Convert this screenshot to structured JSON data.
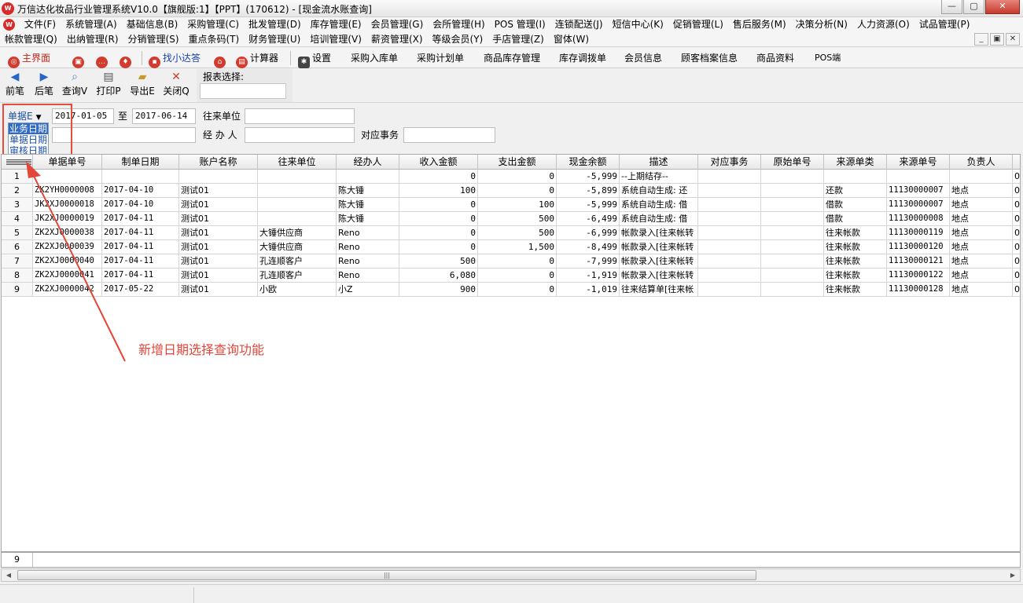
{
  "window": {
    "title": "万信达化妆品行业管理系统V10.0【旗舰版:1】【PPT】(170612) - [现金流水账查询]",
    "buttons": [
      "—",
      "▢",
      "✕"
    ]
  },
  "menubar_row1": [
    "文件(F)",
    "系统管理(A)",
    "基础信息(B)",
    "采购管理(C)",
    "批发管理(D)",
    "库存管理(E)",
    "会员管理(G)",
    "会所管理(H)",
    "POS 管理(I)",
    "连锁配送(J)",
    "短信中心(K)",
    "促销管理(L)",
    "售后服务(M)",
    "决策分析(N)",
    "人力资源(O)",
    "试品管理(P)"
  ],
  "menubar_row2": [
    "帐款管理(Q)",
    "出纳管理(R)",
    "分销管理(S)",
    "重点条码(T)",
    "财务管理(U)",
    "培训管理(V)",
    "薪资管理(X)",
    "等级会员(Y)",
    "手店管理(Z)",
    "窗体(W)"
  ],
  "mdi_buttons": [
    "_",
    "▣",
    "✕"
  ],
  "quickbar": {
    "home": "主界面",
    "find": "找小达答",
    "calc": "计算器",
    "settings": "设置",
    "links": [
      "采购入库单",
      "采购计划单",
      "商品库存管理",
      "库存调拨单",
      "会员信息",
      "顾客档案信息",
      "商品资料",
      "POS端"
    ]
  },
  "toolbar": {
    "prev": "前笔",
    "next": "后笔",
    "query": "查询V",
    "print": "打印P",
    "export": "导出E",
    "close": "关闭Q",
    "report_label": "报表选择:",
    "report_value": ""
  },
  "filter": {
    "date_type_label": "单据E",
    "date_type_options": [
      "业务日期",
      "单据日期",
      "审核日期"
    ],
    "date_from": "2017-01-05",
    "to_label": "至",
    "date_to": "2017-06-14",
    "partner_label": "往来单位",
    "partner_value": "",
    "handler_label": "经 办 人",
    "handler_value": "",
    "affair_label": "对应事务",
    "affair_value": ""
  },
  "table": {
    "columns": [
      "单据单号",
      "制单日期",
      "账户名称",
      "往来单位",
      "经办人",
      "收入金额",
      "支出金额",
      "现金余额",
      "描述",
      "对应事务",
      "原始单号",
      "来源单类",
      "来源单号",
      "负责人"
    ],
    "rows": [
      [
        "1",
        "",
        "",
        "",
        "",
        "",
        "0",
        "0",
        "-5,999",
        "--上期结存--",
        "",
        "",
        "",
        "",
        ""
      ],
      [
        "2",
        "ZK2YH0000008",
        "2017-04-10",
        "测试01",
        "",
        "陈大锤",
        "100",
        "0",
        "-5,899",
        "系统自动生成: 还",
        "",
        "",
        "还款",
        "11130000007",
        "地点"
      ],
      [
        "3",
        "JK2XJ0000018",
        "2017-04-10",
        "测试01",
        "",
        "陈大锤",
        "0",
        "100",
        "-5,999",
        "系统自动生成: 借",
        "",
        "",
        "借款",
        "11130000007",
        "地点"
      ],
      [
        "4",
        "JK2XJ0000019",
        "2017-04-11",
        "测试01",
        "",
        "陈大锤",
        "0",
        "500",
        "-6,499",
        "系统自动生成: 借",
        "",
        "",
        "借款",
        "11130000008",
        "地点"
      ],
      [
        "5",
        "ZK2XJ0000038",
        "2017-04-11",
        "测试01",
        "大锤供应商",
        "Reno",
        "0",
        "500",
        "-6,999",
        "帐款录入[往来帐转",
        "",
        "",
        "往来帐款",
        "11130000119",
        "地点"
      ],
      [
        "6",
        "ZK2XJ0000039",
        "2017-04-11",
        "测试01",
        "大锤供应商",
        "Reno",
        "0",
        "1,500",
        "-8,499",
        "帐款录入[往来帐转",
        "",
        "",
        "往来帐款",
        "11130000120",
        "地点"
      ],
      [
        "7",
        "ZK2XJ0000040",
        "2017-04-11",
        "测试01",
        "孔连顺客户",
        "Reno",
        "500",
        "0",
        "-7,999",
        "帐款录入[往来帐转",
        "",
        "",
        "往来帐款",
        "11130000121",
        "地点"
      ],
      [
        "8",
        "ZK2XJ0000041",
        "2017-04-11",
        "测试01",
        "孔连顺客户",
        "Reno",
        "6,080",
        "0",
        "-1,919",
        "帐款录入[往来帐转",
        "",
        "",
        "往来帐款",
        "11130000122",
        "地点"
      ],
      [
        "9",
        "ZK2XJ0000042",
        "2017-05-22",
        "测试01",
        "小欧",
        "小Z",
        "900",
        "0",
        "-1,019",
        "往来结算单[往来帐",
        "",
        "",
        "往来帐款",
        "11130000128",
        "地点"
      ]
    ],
    "row_count": "9"
  },
  "annotation": "新增日期选择查询功能",
  "colors": {
    "annotation": "#e4463a",
    "selected": "#316ac5",
    "link": "#1a4fb3"
  }
}
